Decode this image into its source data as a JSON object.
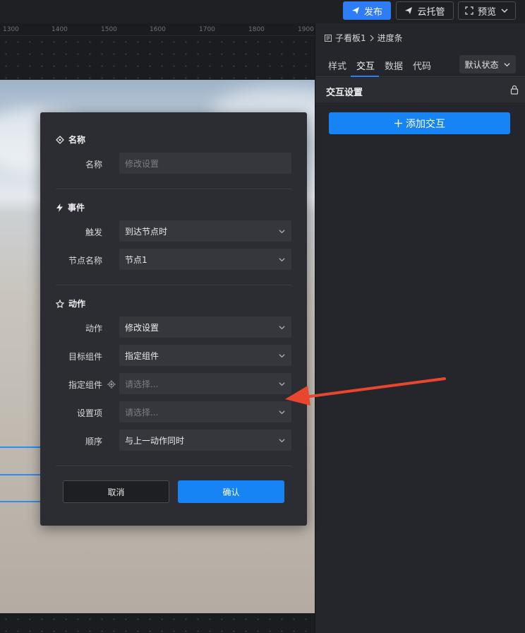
{
  "topbar": {
    "publish_label": "发布",
    "cloud_label": "云托管",
    "preview_label": "预览"
  },
  "ruler": {
    "labels": [
      "1300",
      "1400",
      "1500",
      "1600",
      "1700",
      "1800",
      "1900"
    ]
  },
  "panel": {
    "breadcrumb": {
      "parent": "子看板1",
      "current": "进度条"
    },
    "tabs": [
      "样式",
      "交互",
      "数据",
      "代码"
    ],
    "active_tab": "交互",
    "state_label": "默认状态",
    "section_title": "交互设置",
    "add_label": "添加交互"
  },
  "modal": {
    "name_section": {
      "title": "名称",
      "label": "名称",
      "placeholder": "修改设置"
    },
    "event_section": {
      "title": "事件",
      "trigger_label": "触发",
      "trigger_value": "到达节点时",
      "node_label": "节点名称",
      "node_value": "节点1"
    },
    "action_section": {
      "title": "动作",
      "action_label": "动作",
      "action_value": "修改设置",
      "target_label": "目标组件",
      "target_value": "指定组件",
      "specified_label": "指定组件",
      "specified_placeholder": "请选择...",
      "setting_label": "设置项",
      "setting_placeholder": "请选择...",
      "order_label": "顺序",
      "order_value": "与上一动作同时"
    },
    "cancel_label": "取消",
    "confirm_label": "确认"
  },
  "colors": {
    "accent": "#1784f5",
    "annotation_arrow": "#e8462f"
  }
}
